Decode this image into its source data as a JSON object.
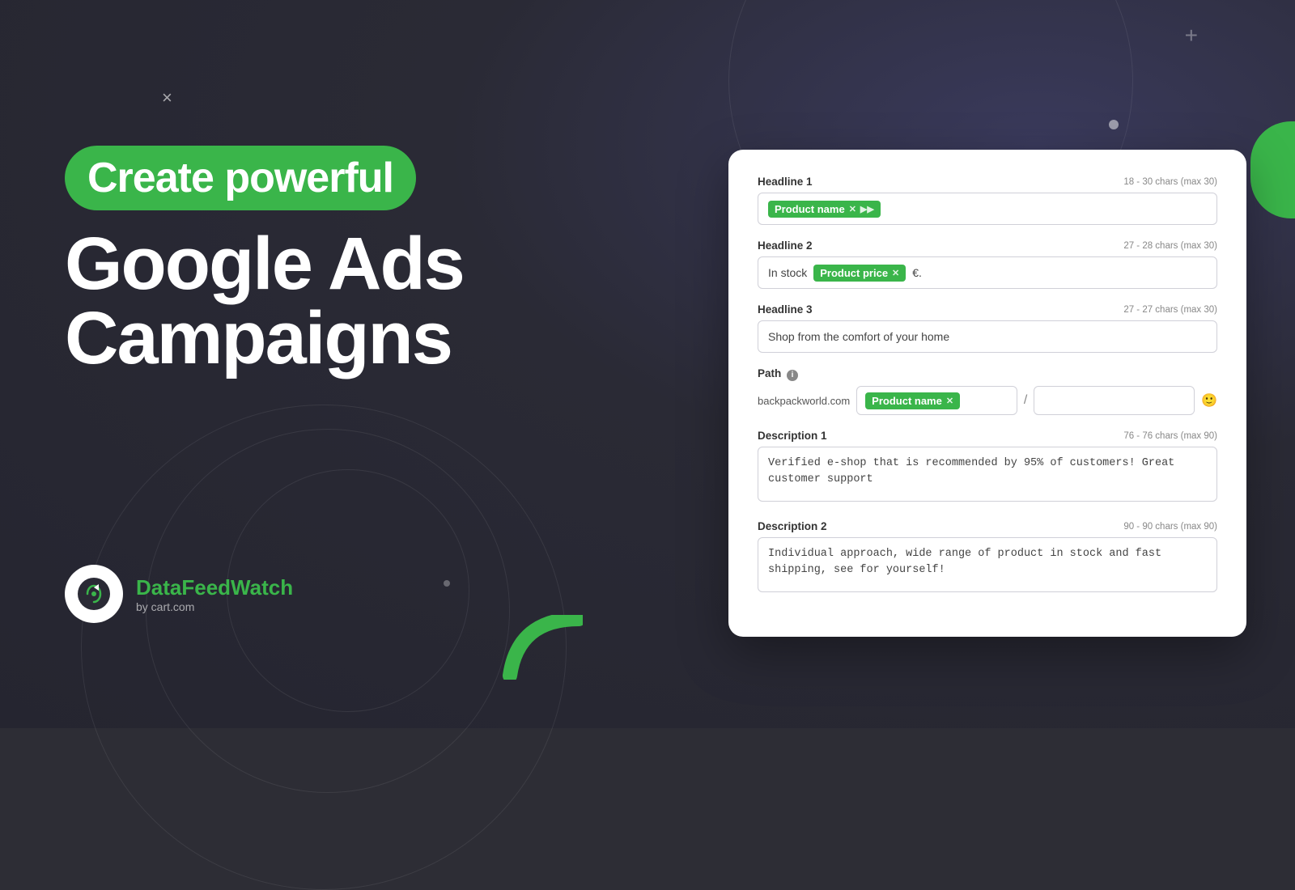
{
  "background": {
    "color": "#2a2a35"
  },
  "close_button": "×",
  "left": {
    "badge_text": "Create powerful",
    "headline_line1": "Google Ads",
    "headline_line2": "Campaigns"
  },
  "logo": {
    "name_part1": "DataFeed",
    "name_part2": "Watch",
    "sub": "by cart.com"
  },
  "decorative": {
    "plus_tr": "+",
    "plus_br": "+",
    "dot_tr": ""
  },
  "form": {
    "headline1": {
      "label": "Headline 1",
      "chars": "18 - 30 chars (max 30)",
      "tag": "Product name",
      "tag_has_x": true,
      "tag_has_arrow": true
    },
    "headline2": {
      "label": "Headline 2",
      "chars": "27 - 28 chars (max 30)",
      "prefix_text": "In stock",
      "tag": "Product price",
      "tag_has_x": true,
      "suffix_text": "€."
    },
    "headline3": {
      "label": "Headline 3",
      "chars": "27 - 27 chars (max 30)",
      "value": "Shop from the comfort of your home"
    },
    "path": {
      "label": "Path",
      "has_info": true,
      "domain": "backpackworld.com",
      "segment1_tag": "Product name",
      "segment1_has_x": true,
      "segment2_value": ""
    },
    "description1": {
      "label": "Description 1",
      "chars": "76 - 76 chars (max 90)",
      "value": "Verified e-shop that is recommended by 95% of customers! Great customer support"
    },
    "description2": {
      "label": "Description 2",
      "chars": "90 - 90 chars (max 90)",
      "value": "Individual approach, wide range of product in stock and fast shipping, see for yourself!"
    }
  }
}
